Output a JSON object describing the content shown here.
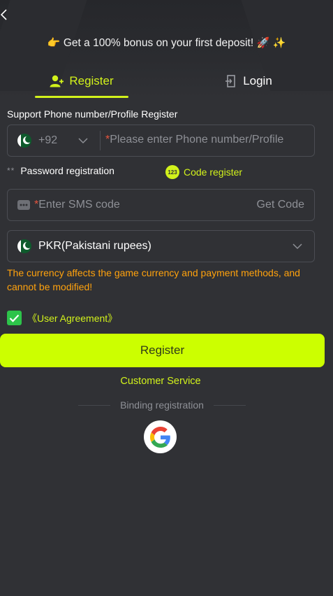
{
  "promo": {
    "icon_left": "pointing-hand-icon",
    "text": "Get a 100% bonus on your first deposit!",
    "icon_right_1": "rocket-icon",
    "icon_right_2": "sparkles-icon"
  },
  "tabs": {
    "register_label": "Register",
    "login_label": "Login",
    "active": "register"
  },
  "form": {
    "support_label": "Support Phone number/Profile Register",
    "phone": {
      "country_code": "+92",
      "country_flag": "pakistan-flag-icon",
      "required_mark": "*",
      "placeholder": "Please enter Phone number/Profile"
    },
    "modes": {
      "password_stars": "**",
      "password_label": "Password registration",
      "code_badge": "123",
      "code_label": "Code register"
    },
    "sms": {
      "required_mark": "*",
      "placeholder": "Enter SMS code",
      "get_code_label": "Get Code"
    },
    "currency": {
      "value": "PKR(Pakistani rupees)"
    },
    "warning": "The currency affects the game currency and payment methods, and cannot be modified!",
    "agreement": {
      "checked": true,
      "label": "《User Agreement》"
    },
    "register_button": "Register"
  },
  "footer": {
    "customer_service": "Customer Service",
    "binding_label": "Binding registration",
    "google_icon": "google-icon"
  },
  "colors": {
    "accent": "#d2f21b",
    "button": "#ccff00",
    "warning": "#ffa20d",
    "background": "#303135",
    "checkbox": "#2dc44a"
  }
}
